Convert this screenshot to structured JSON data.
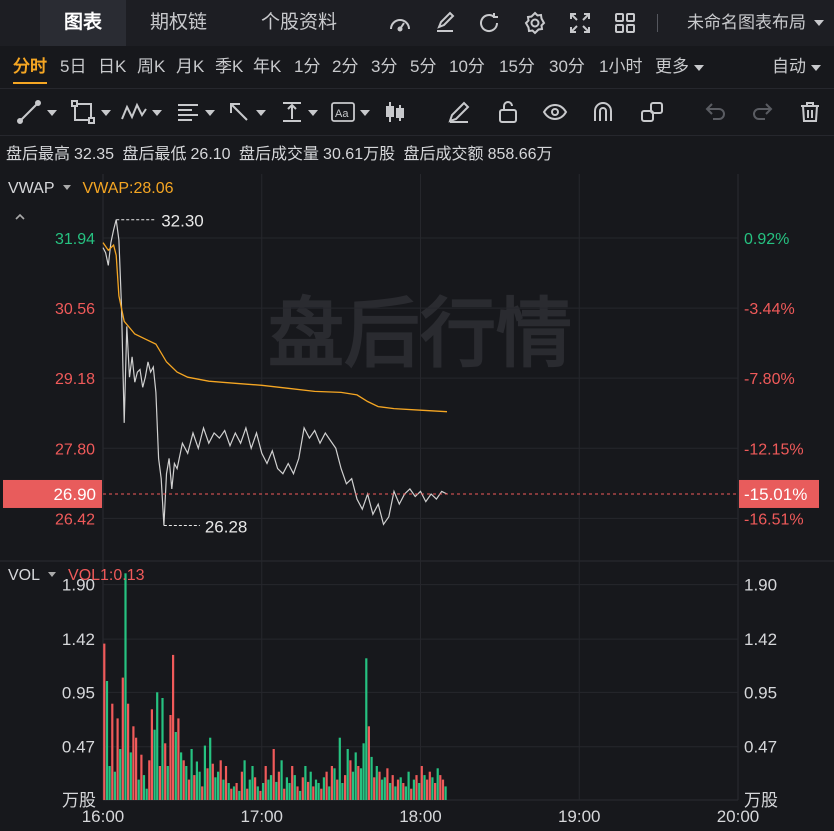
{
  "top_tabs": [
    {
      "label": "图表",
      "active": true
    },
    {
      "label": "期权链",
      "active": false
    },
    {
      "label": "个股资料",
      "active": false
    }
  ],
  "top_icons": [
    "gauge-icon",
    "edit-icon",
    "refresh-icon",
    "gear-icon",
    "fullscreen-icon",
    "grid-icon"
  ],
  "layout_name": "未命名图表布局",
  "periods": [
    "分时",
    "5日",
    "日K",
    "周K",
    "月K",
    "季K",
    "年K",
    "1分",
    "2分",
    "3分",
    "5分",
    "10分",
    "15分",
    "30分",
    "1小时"
  ],
  "more_label": "更多",
  "auto_label": "自动",
  "info": {
    "high_label": "盘后最高",
    "high_value": "32.35",
    "low_label": "盘后最低",
    "low_value": "26.10",
    "vol_label": "盘后成交量",
    "vol_value": "30.61万股",
    "amt_label": "盘后成交额",
    "amt_value": "858.66万"
  },
  "watermark": "盘后行情",
  "colors": {
    "up": "#f05a5a",
    "down": "#26c281",
    "vwap": "#f5a623",
    "price": "#d0d0d0"
  },
  "price_panel": {
    "indicator_name": "VWAP",
    "indicator_value": "VWAP:28.06",
    "left_ticks": [
      "31.94",
      "30.56",
      "29.18",
      "27.80",
      "26.42"
    ],
    "right_ticks": [
      "0.92%",
      "-3.44%",
      "-7.80%",
      "-12.15%",
      "-16.51%"
    ],
    "current_price": "26.90",
    "current_pct": "-15.01%",
    "max_label": "32.30",
    "min_label": "26.28"
  },
  "vol_panel": {
    "indicator_name": "VOL",
    "indicator_value": "VOL1:0.13",
    "ticks": [
      "1.90",
      "1.42",
      "0.95",
      "0.47"
    ],
    "unit": "万股"
  },
  "x_labels": [
    "16:00",
    "17:00",
    "18:00",
    "19:00",
    "20:00"
  ],
  "chart_data": {
    "type": "line",
    "x_range_minutes": [
      0,
      240
    ],
    "price_range": [
      25.6,
      33.2
    ],
    "reference_price": 31.65,
    "price": [
      {
        "t": 0,
        "v": 31.75
      },
      {
        "t": 1,
        "v": 31.65
      },
      {
        "t": 2,
        "v": 31.4
      },
      {
        "t": 3,
        "v": 31.85
      },
      {
        "t": 4,
        "v": 32.1
      },
      {
        "t": 5,
        "v": 32.3
      },
      {
        "t": 6,
        "v": 31.9
      },
      {
        "t": 7,
        "v": 30.6
      },
      {
        "t": 8,
        "v": 28.3
      },
      {
        "t": 9,
        "v": 30.2
      },
      {
        "t": 10,
        "v": 29.2
      },
      {
        "t": 11,
        "v": 29.6
      },
      {
        "t": 12,
        "v": 29.1
      },
      {
        "t": 13,
        "v": 29.3
      },
      {
        "t": 14,
        "v": 29.35
      },
      {
        "t": 15,
        "v": 29.0
      },
      {
        "t": 16,
        "v": 29.2
      },
      {
        "t": 17,
        "v": 29.5
      },
      {
        "t": 18,
        "v": 29.3
      },
      {
        "t": 19,
        "v": 29.4
      },
      {
        "t": 20,
        "v": 28.9
      },
      {
        "t": 21,
        "v": 27.6
      },
      {
        "t": 22,
        "v": 27.2
      },
      {
        "t": 23,
        "v": 26.28
      },
      {
        "t": 24,
        "v": 27.3
      },
      {
        "t": 25,
        "v": 27.6
      },
      {
        "t": 26,
        "v": 27.0
      },
      {
        "t": 27,
        "v": 27.5
      },
      {
        "t": 28,
        "v": 27.4
      },
      {
        "t": 30,
        "v": 27.9
      },
      {
        "t": 32,
        "v": 27.7
      },
      {
        "t": 34,
        "v": 28.1
      },
      {
        "t": 36,
        "v": 27.8
      },
      {
        "t": 38,
        "v": 28.2
      },
      {
        "t": 40,
        "v": 27.9
      },
      {
        "t": 42,
        "v": 28.1
      },
      {
        "t": 44,
        "v": 28.0
      },
      {
        "t": 46,
        "v": 28.15
      },
      {
        "t": 48,
        "v": 27.85
      },
      {
        "t": 50,
        "v": 28.1
      },
      {
        "t": 52,
        "v": 27.9
      },
      {
        "t": 54,
        "v": 28.2
      },
      {
        "t": 56,
        "v": 27.8
      },
      {
        "t": 58,
        "v": 28.1
      },
      {
        "t": 60,
        "v": 27.7
      },
      {
        "t": 62,
        "v": 27.5
      },
      {
        "t": 64,
        "v": 27.75
      },
      {
        "t": 66,
        "v": 27.4
      },
      {
        "t": 68,
        "v": 27.3
      },
      {
        "t": 70,
        "v": 27.5
      },
      {
        "t": 72,
        "v": 27.3
      },
      {
        "t": 74,
        "v": 27.6
      },
      {
        "t": 76,
        "v": 28.2
      },
      {
        "t": 78,
        "v": 28.0
      },
      {
        "t": 80,
        "v": 28.15
      },
      {
        "t": 82,
        "v": 27.9
      },
      {
        "t": 84,
        "v": 28.1
      },
      {
        "t": 86,
        "v": 27.95
      },
      {
        "t": 88,
        "v": 27.8
      },
      {
        "t": 90,
        "v": 27.4
      },
      {
        "t": 92,
        "v": 27.1
      },
      {
        "t": 94,
        "v": 27.2
      },
      {
        "t": 96,
        "v": 26.8
      },
      {
        "t": 98,
        "v": 26.6
      },
      {
        "t": 100,
        "v": 26.9
      },
      {
        "t": 102,
        "v": 26.5
      },
      {
        "t": 104,
        "v": 26.7
      },
      {
        "t": 106,
        "v": 26.3
      },
      {
        "t": 108,
        "v": 26.45
      },
      {
        "t": 110,
        "v": 26.95
      },
      {
        "t": 112,
        "v": 26.7
      },
      {
        "t": 114,
        "v": 26.9
      },
      {
        "t": 116,
        "v": 27.0
      },
      {
        "t": 118,
        "v": 26.85
      },
      {
        "t": 120,
        "v": 26.95
      },
      {
        "t": 122,
        "v": 26.75
      },
      {
        "t": 124,
        "v": 26.9
      },
      {
        "t": 126,
        "v": 26.8
      },
      {
        "t": 128,
        "v": 26.95
      },
      {
        "t": 130,
        "v": 26.9
      }
    ],
    "vwap": [
      {
        "t": 0,
        "v": 31.85
      },
      {
        "t": 2,
        "v": 31.7
      },
      {
        "t": 4,
        "v": 31.8
      },
      {
        "t": 5,
        "v": 31.6
      },
      {
        "t": 6,
        "v": 30.8
      },
      {
        "t": 8,
        "v": 30.3
      },
      {
        "t": 12,
        "v": 30.05
      },
      {
        "t": 16,
        "v": 29.95
      },
      {
        "t": 20,
        "v": 29.85
      },
      {
        "t": 24,
        "v": 29.5
      },
      {
        "t": 28,
        "v": 29.3
      },
      {
        "t": 32,
        "v": 29.2
      },
      {
        "t": 40,
        "v": 29.12
      },
      {
        "t": 50,
        "v": 29.08
      },
      {
        "t": 60,
        "v": 29.04
      },
      {
        "t": 70,
        "v": 28.98
      },
      {
        "t": 80,
        "v": 28.92
      },
      {
        "t": 90,
        "v": 28.9
      },
      {
        "t": 96,
        "v": 28.85
      },
      {
        "t": 100,
        "v": 28.72
      },
      {
        "t": 104,
        "v": 28.62
      },
      {
        "t": 110,
        "v": 28.58
      },
      {
        "t": 120,
        "v": 28.55
      },
      {
        "t": 130,
        "v": 28.52
      }
    ],
    "volume_range": [
      0,
      2.1
    ],
    "volume": [
      1.38,
      1.05,
      0.3,
      0.85,
      0.25,
      0.72,
      0.45,
      1.08,
      2.0,
      0.85,
      0.42,
      0.65,
      0.55,
      0.18,
      0.4,
      0.22,
      0.1,
      0.35,
      0.8,
      0.62,
      0.95,
      0.3,
      0.9,
      0.5,
      0.3,
      0.75,
      1.28,
      0.6,
      0.72,
      0.42,
      0.35,
      0.3,
      0.18,
      0.45,
      0.22,
      0.34,
      0.25,
      0.12,
      0.48,
      0.28,
      0.55,
      0.32,
      0.2,
      0.25,
      0.35,
      0.18,
      0.3,
      0.15,
      0.1,
      0.12,
      0.15,
      0.08,
      0.25,
      0.35,
      0.1,
      0.18,
      0.3,
      0.2,
      0.12,
      0.08,
      0.15,
      0.3,
      0.18,
      0.22,
      0.45,
      0.16,
      0.25,
      0.35,
      0.1,
      0.2,
      0.15,
      0.3,
      0.22,
      0.12,
      0.08,
      0.2,
      0.3,
      0.16,
      0.25,
      0.12,
      0.18,
      0.15,
      0.1,
      0.2,
      0.25,
      0.12,
      0.3,
      0.28,
      0.18,
      0.55,
      0.15,
      0.22,
      0.45,
      0.35,
      0.25,
      0.42,
      0.3,
      0.28,
      0.5,
      1.25,
      0.65,
      0.38,
      0.2,
      0.3,
      0.25,
      0.18,
      0.2,
      0.28,
      0.15,
      0.22,
      0.12,
      0.18,
      0.2,
      0.15,
      0.12,
      0.25,
      0.1,
      0.18,
      0.22,
      0.15,
      0.3,
      0.22,
      0.18,
      0.25,
      0.2,
      0.15,
      0.28,
      0.22,
      0.18,
      0.12
    ],
    "volume_up": [
      0,
      1,
      1,
      0,
      1,
      0,
      1,
      0,
      1,
      0,
      1,
      0,
      0,
      1,
      0,
      1,
      1,
      0,
      0,
      1,
      1,
      0,
      1,
      0,
      1,
      0,
      0,
      1,
      0,
      1,
      0,
      1,
      0,
      1,
      0,
      1,
      1,
      0,
      1,
      0,
      1,
      0,
      1,
      1,
      0,
      1,
      0,
      1,
      0,
      1,
      0,
      1,
      0,
      1,
      0,
      1,
      1,
      0,
      1,
      0,
      1,
      0,
      1,
      1,
      0,
      1,
      0,
      1,
      0,
      1,
      1,
      0,
      1,
      0,
      1,
      0,
      1,
      0,
      1,
      0,
      1,
      1,
      0,
      1,
      0,
      1,
      0,
      1,
      0,
      1,
      1,
      0,
      1,
      0,
      1,
      1,
      0,
      1,
      1,
      1,
      0,
      1,
      0,
      1,
      0,
      1,
      1,
      0,
      1,
      0,
      1,
      0,
      1,
      0,
      1,
      1,
      0,
      1,
      0,
      1,
      0,
      1,
      0,
      0,
      1,
      0,
      1,
      0,
      0,
      1
    ]
  }
}
